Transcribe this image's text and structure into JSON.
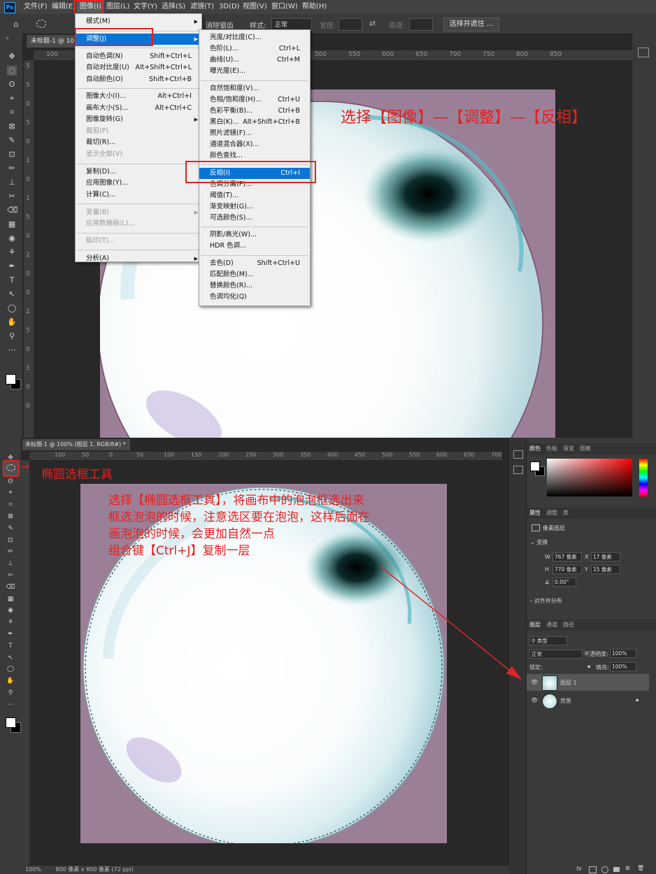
{
  "top": {
    "app_logo": "Ps",
    "menubar": [
      "文件(F)",
      "编辑(E)",
      "图像(I)",
      "图层(L)",
      "文字(Y)",
      "选择(S)",
      "滤镜(T)",
      "3D(D)",
      "视图(V)",
      "窗口(W)",
      "帮助(H)"
    ],
    "options": {
      "antialias": "消除锯齿",
      "style_label": "样式:",
      "style_value": "正常",
      "width_label": "宽度:",
      "height_label": "高度:",
      "select_mask_button": "选择并遮住 ..."
    },
    "doc_tab": "未标题-1 @ 10",
    "ruler_top": [
      "100",
      "150",
      "200",
      "250",
      "300",
      "350",
      "400",
      "450",
      "500",
      "550",
      "600",
      "650",
      "700",
      "750",
      "800",
      "850"
    ],
    "ruler_left": [
      "5",
      "5",
      "0",
      "5",
      "0",
      "1",
      "0",
      "1",
      "5",
      "0",
      "2",
      "0",
      "0",
      "2",
      "5",
      "0",
      "3",
      "0",
      "0"
    ],
    "image_menu": [
      {
        "label": "模式(M)",
        "submenu": true
      },
      {
        "sep": true
      },
      {
        "label": "调整(J)",
        "submenu": true,
        "highlight": true
      },
      {
        "sep": true
      },
      {
        "label": "自动色调(N)",
        "shortcut": "Shift+Ctrl+L"
      },
      {
        "label": "自动对比度(U)",
        "shortcut": "Alt+Shift+Ctrl+L"
      },
      {
        "label": "自动颜色(O)",
        "shortcut": "Shift+Ctrl+B"
      },
      {
        "sep": true
      },
      {
        "label": "图像大小(I)...",
        "shortcut": "Alt+Ctrl+I"
      },
      {
        "label": "画布大小(S)...",
        "shortcut": "Alt+Ctrl+C"
      },
      {
        "label": "图像旋转(G)",
        "submenu": true
      },
      {
        "label": "裁剪(P)",
        "disabled": true
      },
      {
        "label": "裁切(R)..."
      },
      {
        "label": "显示全部(V)",
        "disabled": true
      },
      {
        "sep": true
      },
      {
        "label": "复制(D)..."
      },
      {
        "label": "应用图像(Y)..."
      },
      {
        "label": "计算(C)..."
      },
      {
        "sep": true
      },
      {
        "label": "变量(B)",
        "submenu": true,
        "disabled": true
      },
      {
        "label": "应用数据组(L)...",
        "disabled": true
      },
      {
        "sep": true
      },
      {
        "label": "陷印(T)...",
        "disabled": true
      },
      {
        "sep": true
      },
      {
        "label": "分析(A)",
        "submenu": true
      }
    ],
    "adjust_menu": [
      {
        "label": "亮度/对比度(C)..."
      },
      {
        "label": "色阶(L)...",
        "shortcut": "Ctrl+L"
      },
      {
        "label": "曲线(U)...",
        "shortcut": "Ctrl+M"
      },
      {
        "label": "曝光度(E)..."
      },
      {
        "sep": true
      },
      {
        "label": "自然饱和度(V)..."
      },
      {
        "label": "色相/饱和度(H)...",
        "shortcut": "Ctrl+U"
      },
      {
        "label": "色彩平衡(B)...",
        "shortcut": "Ctrl+B"
      },
      {
        "label": "黑白(K)...",
        "shortcut": "Alt+Shift+Ctrl+B"
      },
      {
        "label": "照片滤镜(F)..."
      },
      {
        "label": "通道混合器(X)..."
      },
      {
        "label": "颜色查找..."
      },
      {
        "sep": true
      },
      {
        "label": "反相(I)",
        "shortcut": "Ctrl+I",
        "highlight": true
      },
      {
        "label": "色调分离(P)..."
      },
      {
        "label": "阈值(T)..."
      },
      {
        "label": "渐变映射(G)..."
      },
      {
        "label": "可选颜色(S)..."
      },
      {
        "sep": true
      },
      {
        "label": "阴影/高光(W)..."
      },
      {
        "label": "HDR 色调..."
      },
      {
        "sep": true
      },
      {
        "label": "去色(D)",
        "shortcut": "Shift+Ctrl+U"
      },
      {
        "label": "匹配颜色(M)..."
      },
      {
        "label": "替换颜色(R)..."
      },
      {
        "label": "色调均化(Q)"
      }
    ],
    "annotation": "选择【图像】—【调整】—【反相】"
  },
  "bottom": {
    "doc_tab": "未标题-1 @ 100% (图层 1, RGB/8#) *",
    "close_glyph": "×",
    "ruler_top": [
      "100",
      "50",
      "0",
      "50",
      "100",
      "150",
      "200",
      "250",
      "300",
      "350",
      "400",
      "450",
      "500",
      "550",
      "600",
      "650",
      "700",
      "750"
    ],
    "tool_annotation": "椭圆选框工具",
    "instructions": [
      "选择【椭圆选框工具】，将画布中的泡泡框选出来",
      "框选泡泡的时候，注意选区要在泡泡，这样后面在",
      "画泡泡的时候，会更加自然一点",
      "组合键【Ctrl+J】复制一层"
    ],
    "status": {
      "zoom": "100%",
      "size": "800 像素 x 800 像素 (72 ppi)"
    },
    "color_panel_tabs": [
      "颜色",
      "色板",
      "渐变",
      "图案"
    ],
    "props_tabs": [
      "属性",
      "调整",
      "库"
    ],
    "props_kind": "像素图层",
    "transform_title": "变换",
    "transform": {
      "w": "767 像素",
      "h": "770 像素",
      "x": "17 像素",
      "y": "15 像素",
      "angle": "0.00°",
      "w_label": "W",
      "h_label": "H",
      "x_label": "X",
      "y_label": "Y"
    },
    "align_title": "对齐并分布",
    "layers_tabs": [
      "图层",
      "通道",
      "路径"
    ],
    "layers_filter": "类型",
    "blend_mode": "正常",
    "opacity_label": "不透明度:",
    "opacity": "100%",
    "lock_label": "锁定:",
    "fill_label": "填充:",
    "fill": "100%",
    "layers": [
      {
        "name": "图层 1",
        "selected": true
      },
      {
        "name": "背景",
        "locked": true
      }
    ],
    "footer_icons": [
      "fx"
    ]
  },
  "colors": {
    "annotation_red": "#e62020",
    "menu_highlight": "#0a74d6",
    "canvas_bg": "#9b7f97"
  }
}
